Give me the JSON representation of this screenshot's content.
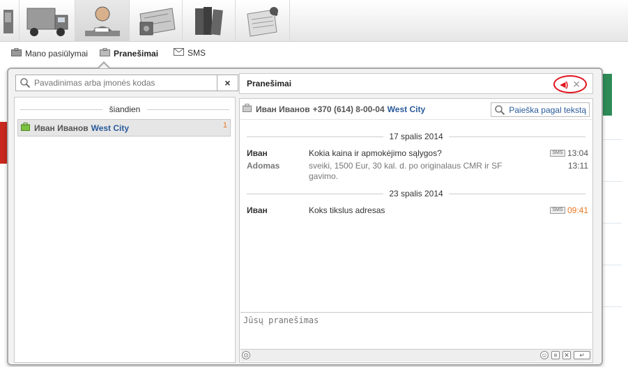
{
  "subnav": {
    "offers_label": "Mano pasiūlymai",
    "messages_label": "Pranešimai",
    "sms_label": "SMS"
  },
  "search": {
    "placeholder": "Pavadinimas arba įmonės kodas",
    "clear_label": "×"
  },
  "contacts": {
    "day_label": "šiandien",
    "items": [
      {
        "name": "Иван Иванов",
        "company": "West City",
        "unread": "1"
      }
    ]
  },
  "panel": {
    "title": "Pranešimai",
    "sound_label": "◀)",
    "close_label": "✕"
  },
  "chat": {
    "contact_name": "Иван Иванов",
    "phone": "+370 (614) 8-00-04",
    "company": "West City",
    "text_search_label": "Paieška pagal tekstą",
    "groups": [
      {
        "date": "17 spalis 2014",
        "messages": [
          {
            "sender": "Иван",
            "text": "Kokia kaina ir apmokėjimo sąlygos?",
            "time": "13:04",
            "sms": true
          },
          {
            "sender": "Adomas",
            "text": "sveiki, 1500 Eur, 30 kal. d. po originalaus CMR ir SF gavimo.",
            "time": "13:11",
            "sms": false
          }
        ]
      },
      {
        "date": "23 spalis 2014",
        "messages": [
          {
            "sender": "Иван",
            "text": "Koks tikslus adresas",
            "time": "09:41",
            "sms": true
          }
        ]
      }
    ],
    "sms_badge": "SMS",
    "compose_placeholder": "Jūsų pranešimas"
  },
  "colors": {
    "accent_blue": "#2a5a9a",
    "unread_orange": "#e87722",
    "highlight_red": "#e0141e"
  },
  "icons": {
    "top": [
      "partial-icon",
      "truck-icon",
      "person-desk-icon",
      "map-calculator-icon",
      "books-icon",
      "newspaper-pin-icon"
    ],
    "envelope": "envelope-icon",
    "briefcase": "briefcase-icon"
  }
}
